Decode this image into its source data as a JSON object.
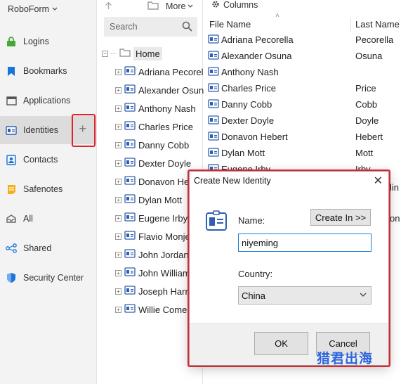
{
  "app": {
    "brand": "RoboForm"
  },
  "sidebar": {
    "items": [
      {
        "label": "Logins",
        "icon": "lock-icon",
        "color": "#44a832"
      },
      {
        "label": "Bookmarks",
        "icon": "bookmark-icon",
        "color": "#1a73d9"
      },
      {
        "label": "Applications",
        "icon": "application-icon",
        "color": "#555555"
      },
      {
        "label": "Identities",
        "icon": "identity-card-icon",
        "color": "#2f5fae"
      },
      {
        "label": "Contacts",
        "icon": "contact-icon",
        "color": "#1a73d9"
      },
      {
        "label": "Safenotes",
        "icon": "note-icon",
        "color": "#f2b01e"
      },
      {
        "label": "All",
        "icon": "stack-icon",
        "color": "#666666"
      },
      {
        "label": "Shared",
        "icon": "share-icon",
        "color": "#1a73d9"
      },
      {
        "label": "Security Center",
        "icon": "shield-icon",
        "color": "#1a73d9"
      }
    ],
    "add_label": "+"
  },
  "toolbar": {
    "more_label": "More"
  },
  "search": {
    "placeholder": "Search"
  },
  "tree": {
    "root": "Home",
    "items": [
      "Adriana Pecorella",
      "Alexander Osuna",
      "Anthony Nash",
      "Charles Price",
      "Danny Cobb",
      "Dexter Doyle",
      "Donavon Hebert",
      "Dylan Mott",
      "Eugene Irby",
      "Flavio Monje",
      "John Jordan",
      "John Williams",
      "Joseph Harris",
      "Willie Comer"
    ]
  },
  "list": {
    "columns_label": "Columns",
    "headers": {
      "file_name": "File Name",
      "last_name": "Last Name"
    },
    "rows": [
      {
        "file": "Adriana Pecorella",
        "last": "Pecorella"
      },
      {
        "file": "Alexander Osuna",
        "last": "Osuna"
      },
      {
        "file": "Anthony Nash",
        "last": ""
      },
      {
        "file": "Charles Price",
        "last": "Price"
      },
      {
        "file": "Danny Cobb",
        "last": "Cobb"
      },
      {
        "file": "Dexter Doyle",
        "last": "Doyle"
      },
      {
        "file": "Donavon Hebert",
        "last": "Hebert"
      },
      {
        "file": "Dylan Mott",
        "last": "Mott"
      },
      {
        "file": "Eugene Irby",
        "last": "Irby"
      }
    ],
    "partial_right_texts": [
      "lin",
      "on"
    ]
  },
  "dialog": {
    "title": "Create New Identity",
    "name_label": "Name:",
    "name_value": "niyeming",
    "create_in_label": "Create In >>",
    "country_label": "Country:",
    "country_value": "China",
    "ok_label": "OK",
    "cancel_label": "Cancel"
  },
  "watermark": {
    "text": "猎君出海",
    "color": "#2a64e0"
  },
  "colors": {
    "highlight": "#e0242e",
    "accent": "#1c7fd0"
  }
}
